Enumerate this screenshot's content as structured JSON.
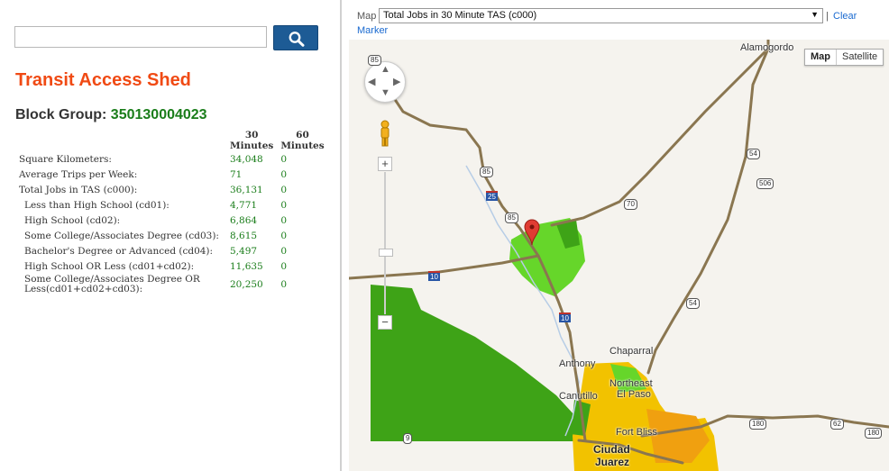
{
  "search": {
    "value": "",
    "placeholder": "",
    "button_icon": "search-icon"
  },
  "panel": {
    "title": "Transit Access Shed",
    "block_group_label": "Block Group:",
    "block_group_id": "350130004023",
    "headers": {
      "col30": "30 Minutes",
      "col60": "60 Minutes"
    },
    "rows": [
      {
        "label": "Square Kilometers:",
        "v30": "34,048",
        "v60": "0",
        "indent": false
      },
      {
        "label": "Average Trips per Week:",
        "v30": "71",
        "v60": "0",
        "indent": false
      },
      {
        "label": "Total Jobs in TAS (c000):",
        "v30": "36,131",
        "v60": "0",
        "indent": false
      },
      {
        "label": "Less than High School (cd01):",
        "v30": "4,771",
        "v60": "0",
        "indent": true
      },
      {
        "label": "High School (cd02):",
        "v30": "6,864",
        "v60": "0",
        "indent": true
      },
      {
        "label": "Some College/Associates Degree (cd03):",
        "v30": "8,615",
        "v60": "0",
        "indent": true
      },
      {
        "label": "Bachelor's Degree or Advanced (cd04):",
        "v30": "5,497",
        "v60": "0",
        "indent": true
      },
      {
        "label": "High School OR Less (cd01+cd02):",
        "v30": "11,635",
        "v60": "0",
        "indent": true
      },
      {
        "label": "Some College/Associates Degree OR Less(cd01+cd02+cd03):",
        "v30": "20,250",
        "v60": "0",
        "indent": true
      }
    ]
  },
  "map_header": {
    "map_label": "Map",
    "layer_selected": "Total Jobs in 30 Minute TAS (c000)",
    "separator": "|",
    "clear_label": "Clear",
    "marker_label": "Marker"
  },
  "map": {
    "type_buttons": {
      "map": "Map",
      "satellite": "Satellite"
    },
    "zoom": {
      "plus": "+",
      "minus": "−"
    },
    "places": {
      "alamogordo": "Alamogordo",
      "chaparral": "Chaparral",
      "anthony": "Anthony",
      "northeast": "Northeast",
      "el_paso": "El Paso",
      "canutillo": "Canutillo",
      "fort_bliss": "Fort Bliss",
      "ciudad": "Ciudad",
      "juarez": "Juarez"
    },
    "shields": {
      "us85_a": "85",
      "us85_b": "85",
      "us85_c": "85",
      "i25": "25",
      "i10_a": "10",
      "i10_b": "10",
      "us70": "70",
      "us54_a": "54",
      "us54_b": "54",
      "r506": "506",
      "r180_a": "180",
      "r180_b": "180",
      "r62": "62",
      "r9": "9"
    },
    "colors": {
      "dark_green": "#3ea317",
      "light_green": "#66d62a",
      "yellow": "#f2c200",
      "orange": "#f0a010",
      "road": "#8a7650",
      "land": "#f5f3ee"
    }
  }
}
